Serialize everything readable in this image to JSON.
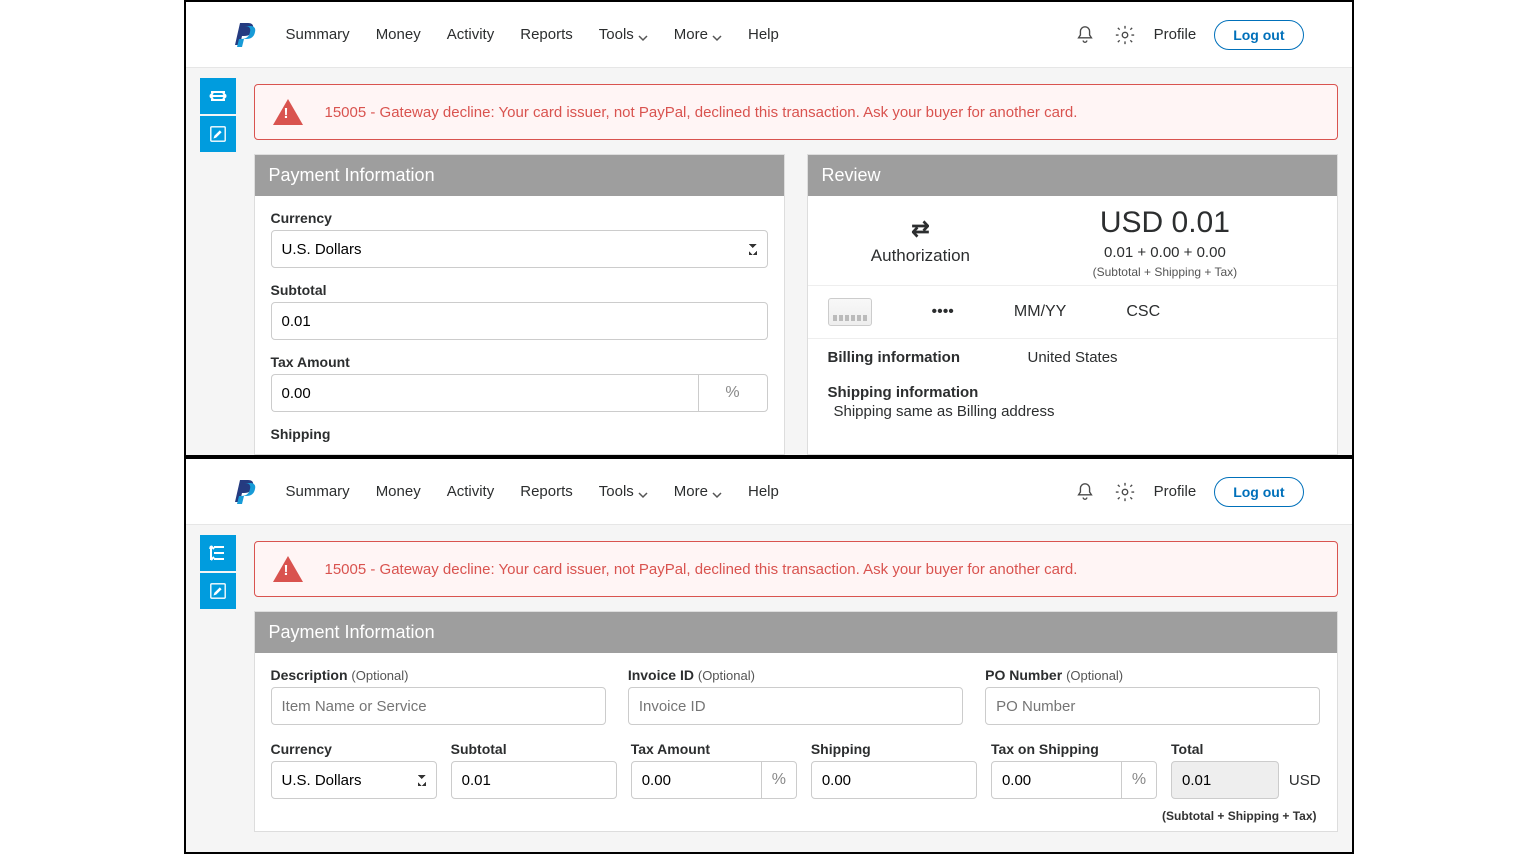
{
  "nav": {
    "summary": "Summary",
    "money": "Money",
    "activity": "Activity",
    "reports": "Reports",
    "tools": "Tools",
    "more": "More",
    "help": "Help",
    "profile": "Profile",
    "logout": "Log out"
  },
  "alert": {
    "text": "15005 - Gateway decline: Your card issuer, not PayPal, declined this transaction. Ask your buyer for another card."
  },
  "panel1": {
    "payment_info": "Payment Information",
    "review": "Review",
    "currency_label": "Currency",
    "currency_value": "U.S. Dollars",
    "subtotal_label": "Subtotal",
    "subtotal_value": "0.01",
    "tax_label": "Tax Amount",
    "tax_value": "0.00",
    "tax_unit": "%",
    "shipping_label": "Shipping",
    "auth_label": "Authorization",
    "big_amount": "USD 0.01",
    "sub_amount": "0.01 + 0.00 + 0.00",
    "sub_note": "(Subtotal + Shipping + Tax)",
    "cc_mask": "••••",
    "cc_exp": "MM/YY",
    "cc_csc": "CSC",
    "billing_label": "Billing information",
    "billing_value": "United States",
    "shipping_info_label": "Shipping information",
    "shipping_info_value": "Shipping same as Billing address"
  },
  "panel2": {
    "payment_info": "Payment Information",
    "description_label": "Description",
    "description_opt": "(Optional)",
    "description_ph": "Item Name or Service",
    "invoice_label": "Invoice ID",
    "invoice_opt": "(Optional)",
    "invoice_ph": "Invoice ID",
    "po_label": "PO Number",
    "po_opt": "(Optional)",
    "po_ph": "PO Number",
    "currency_label": "Currency",
    "currency_value": "U.S. Dollars",
    "subtotal_label": "Subtotal",
    "subtotal_value": "0.01",
    "tax_label": "Tax Amount",
    "tax_value": "0.00",
    "tax_unit": "%",
    "shipping_label": "Shipping",
    "shipping_value": "0.00",
    "tos_label": "Tax on Shipping",
    "tos_value": "0.00",
    "tos_unit": "%",
    "total_label": "Total",
    "total_value": "0.01",
    "total_suffix": "USD",
    "note": "(Subtotal + Shipping + Tax)"
  }
}
